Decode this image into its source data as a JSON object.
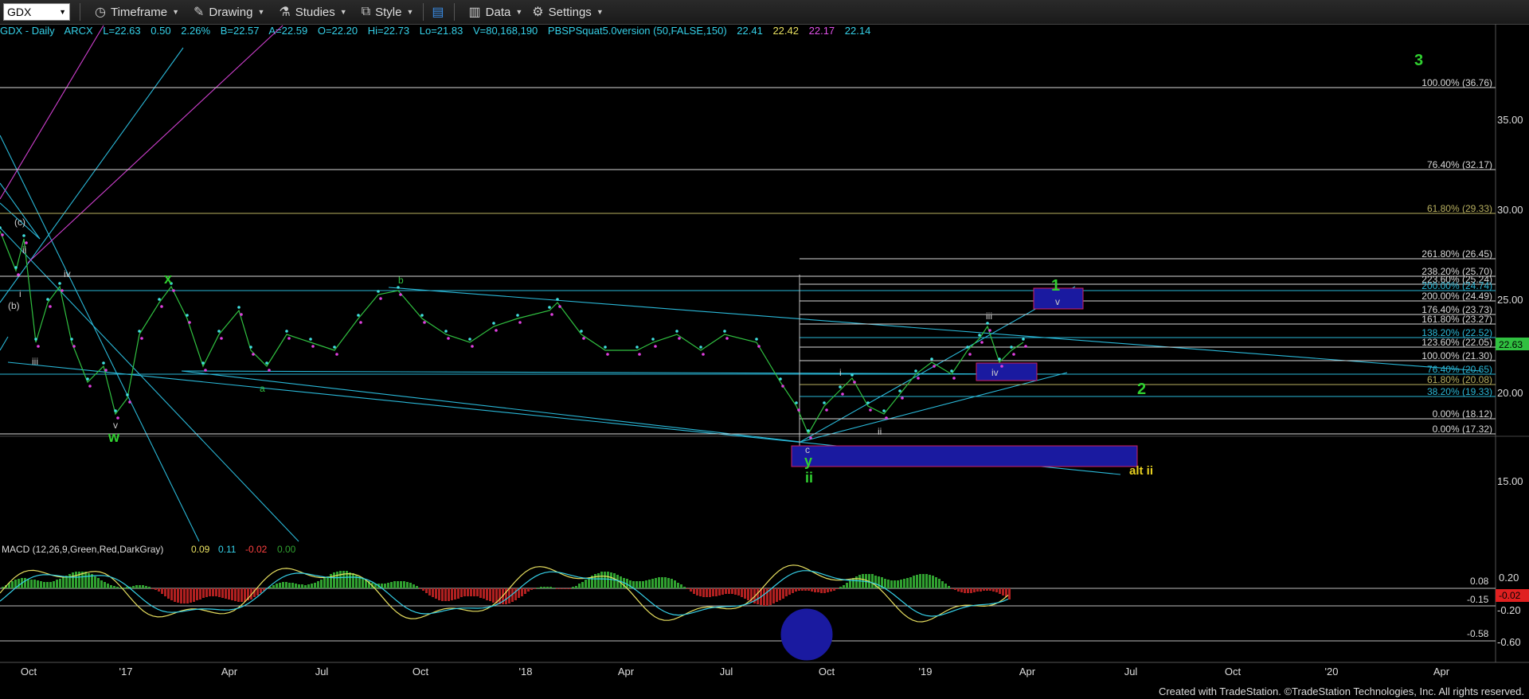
{
  "toolbar": {
    "symbol": "GDX",
    "items": [
      {
        "label": "Timeframe",
        "icon": "clock-icon"
      },
      {
        "label": "Drawing",
        "icon": "pencil-icon"
      },
      {
        "label": "Studies",
        "icon": "flask-icon"
      },
      {
        "label": "Style",
        "icon": "style-icon"
      },
      {
        "label": "Data",
        "icon": "chart-bars-icon"
      },
      {
        "label": "Settings",
        "icon": "gear-icon"
      }
    ]
  },
  "infobar": {
    "title": "GDX - Daily",
    "exchange": "ARCX",
    "last": "L=22.63",
    "change": "0.50",
    "change_pct": "2.26%",
    "bid": "B=22.57",
    "ask": "A=22.59",
    "open": "O=22.20",
    "high": "Hi=22.73",
    "low": "Lo=21.83",
    "volume": "V=80,168,190",
    "study": "PBSPSquat5.0version (50,FALSE,150)",
    "study_values": [
      "22.41",
      "22.42",
      "22.17",
      "22.14"
    ],
    "study_colors": [
      "#35d0e8",
      "#e8e060",
      "#e050e8",
      "#35d0e8"
    ]
  },
  "price_axis": [
    "35.00",
    "30.00",
    "25.00",
    "20.00",
    "15.00"
  ],
  "last_price_tag": "22.63",
  "fib_levels": [
    {
      "label": "100.00% (36.76)",
      "color": "#d8d8d8"
    },
    {
      "label": "76.40% (32.17)",
      "color": "#d8d8d8"
    },
    {
      "label": "61.80% (29.33)",
      "color": "#b8b060"
    },
    {
      "label": "261.80% (26.45)",
      "color": "#d8d8d8"
    },
    {
      "label": "238.20% (25.70)",
      "color": "#d8d8d8"
    },
    {
      "label": "223.60% (25.24)",
      "color": "#d8d8d8"
    },
    {
      "label": "200.00% (24.74)",
      "color": "#2ab8d8"
    },
    {
      "label": "200.00% (24.49)",
      "color": "#d8d8d8"
    },
    {
      "label": "176.40% (23.73)",
      "color": "#d8d8d8"
    },
    {
      "label": "161.80% (23.27)",
      "color": "#d8d8d8"
    },
    {
      "label": "138.20% (22.52)",
      "color": "#2ab8d8"
    },
    {
      "label": "123.60% (22.05)",
      "color": "#d8d8d8"
    },
    {
      "label": "100.00% (21.30)",
      "color": "#d8d8d8"
    },
    {
      "label": "76.40% (20.65)",
      "color": "#2ab8d8"
    },
    {
      "label": "61.80% (20.08)",
      "color": "#b8b060"
    },
    {
      "label": "38.20% (19.33)",
      "color": "#2ab8d8"
    },
    {
      "label": "0.00% (18.12)",
      "color": "#d8d8d8"
    },
    {
      "label": "0.00% (17.32)",
      "color": "#d8d8d8"
    }
  ],
  "wave_labels": {
    "green_3": "3",
    "green_1": "1",
    "green_2": "2",
    "green_w": "w",
    "green_x": "x",
    "green_y": "y",
    "green_ii": "ii",
    "alt_ii": "alt ii",
    "b_label": "b",
    "a_label": "a",
    "c_paren": "(c)",
    "b_paren": "(b)",
    "small_ii": "ii",
    "small_i": "i",
    "small_iv": "iv",
    "small_iii": "iii",
    "small_v": "v",
    "sub_i": "i",
    "sub_ii": "ii",
    "sub_iii": "iii",
    "sub_iv": "iv",
    "sub_v": "v",
    "sub_c": "c"
  },
  "macd": {
    "title": "MACD (12,26,9,Green,Red,DarkGray)",
    "values": [
      "0.09",
      "0.11",
      "-0.02",
      "0.00"
    ],
    "value_colors": [
      "#e8e060",
      "#35d0e8",
      "#ff4040",
      "#30a030"
    ],
    "axis": [
      "0.20",
      "-0.20",
      "-0.60"
    ],
    "levels": [
      "0.08",
      "-0.15",
      "-0.58"
    ],
    "tag": "-0.02"
  },
  "time_axis": [
    "Oct",
    "'17",
    "Apr",
    "Jul",
    "Oct",
    "'18",
    "Apr",
    "Jul",
    "Oct",
    "'19",
    "Apr",
    "Jul",
    "Oct",
    "'20",
    "Apr"
  ],
  "footer": "Created with TradeStation. ©TradeStation Technologies, Inc. All rights reserved."
}
